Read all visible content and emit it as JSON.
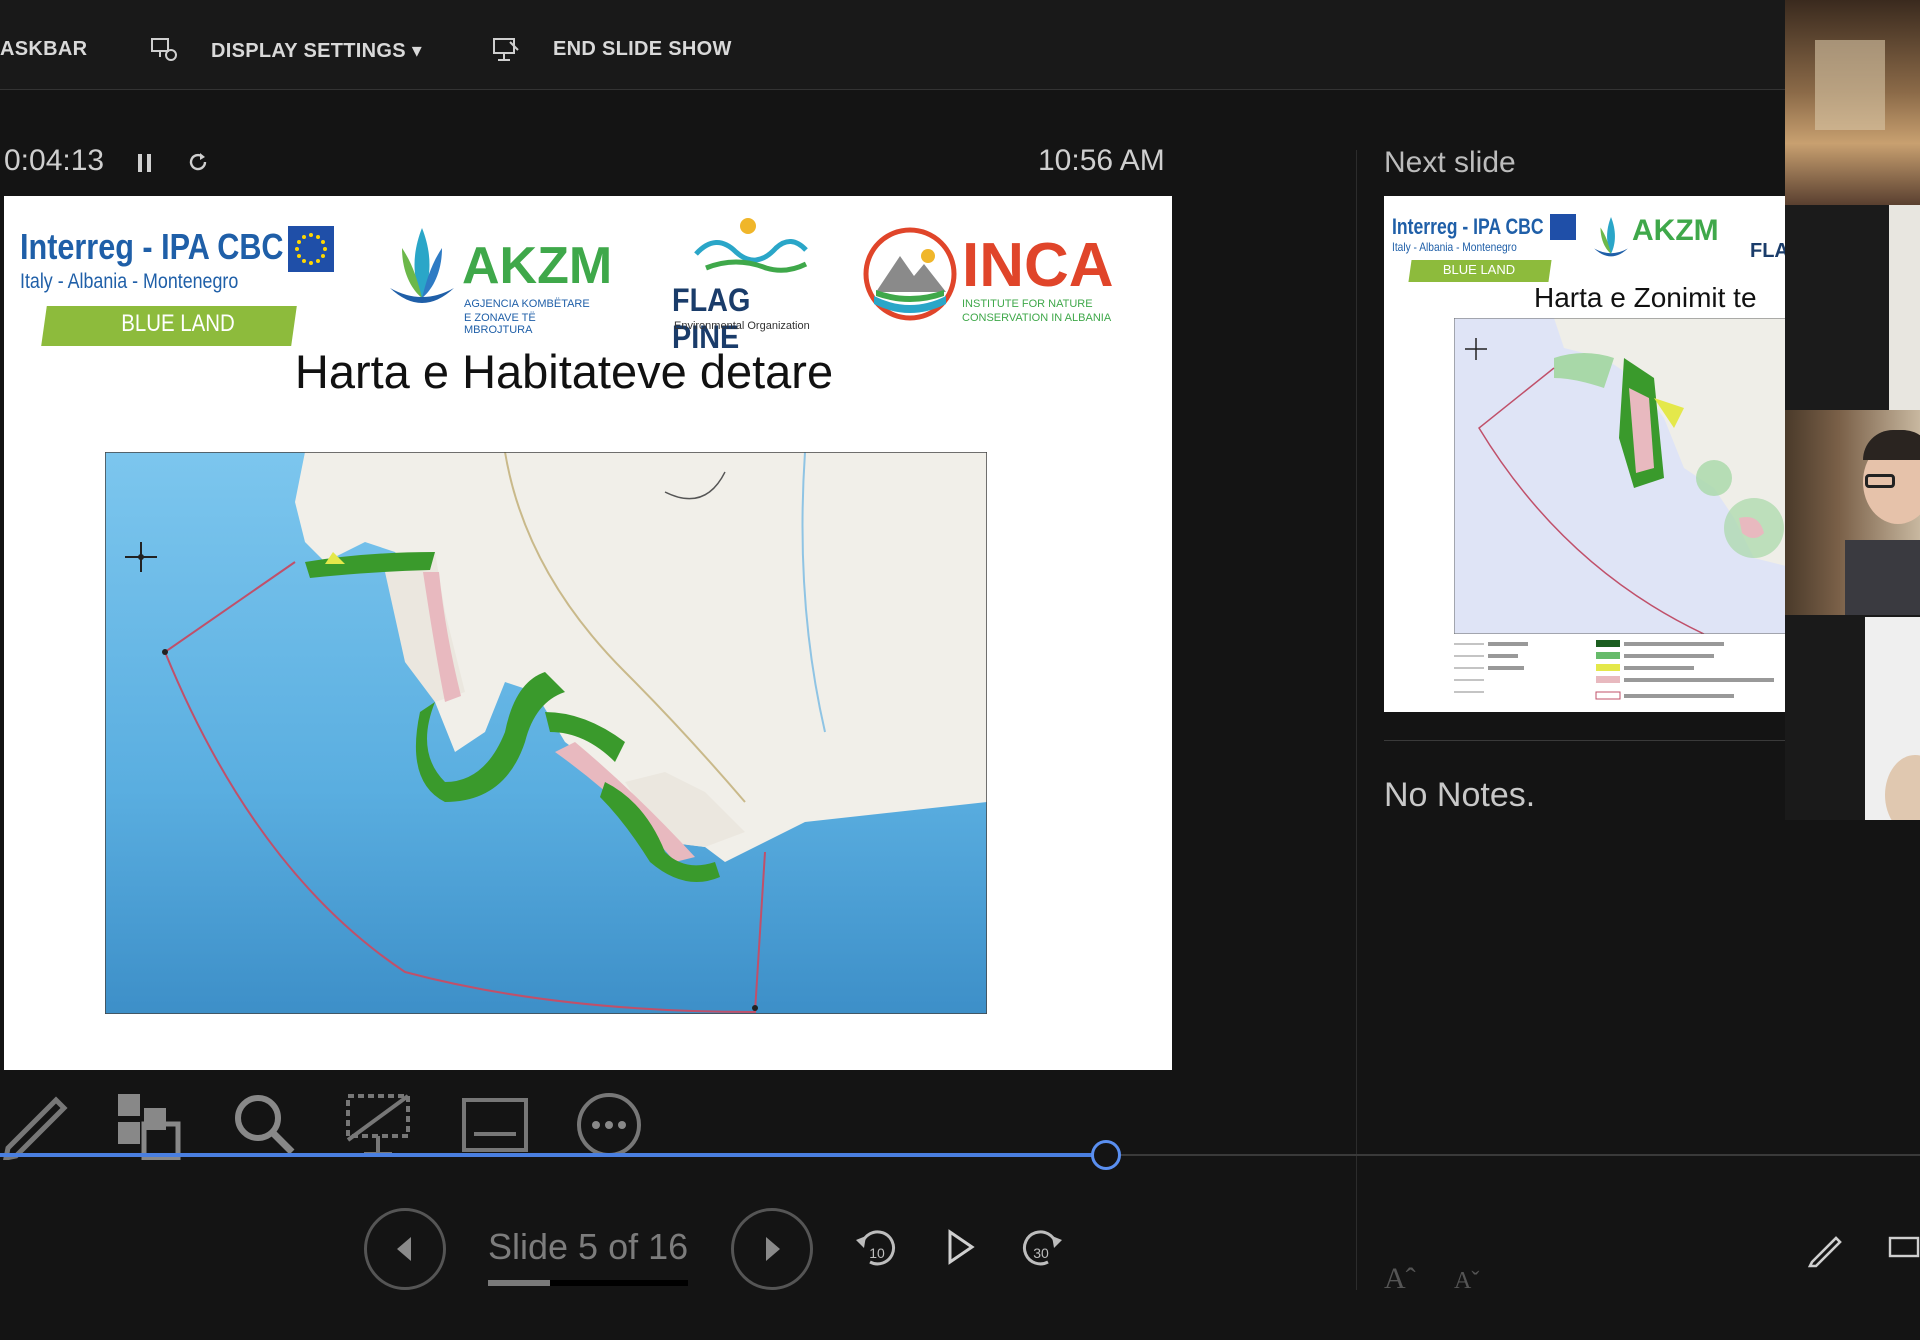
{
  "toolbar": {
    "taskbar_label": "ASKBAR",
    "display_settings_label": "DISPLAY SETTINGS ▾",
    "end_show_label": "END SLIDE SHOW"
  },
  "presenter": {
    "elapsed": "0:04:13",
    "clock": "10:56 AM",
    "next_slide_label": "Next slide",
    "notes": "No Notes.",
    "progress_fraction": 0.576
  },
  "current_slide": {
    "title": "Harta e Habitateve detare",
    "logos": {
      "interreg": "Interreg - IPA CBC",
      "interreg_sub": "Italy - Albania - Montenegro",
      "blueland": "BLUE LAND",
      "akzm": "AKZM",
      "akzm_sub1": "AGJENCIA KOMBËTARE",
      "akzm_sub2": "E ZONAVE TË MBROJTURA",
      "flagpine": "FLAG PINE",
      "flagpine_sub": "Environmental Organization",
      "inca": "INCA",
      "inca_sub1": "INSTITUTE FOR NATURE",
      "inca_sub2": "CONSERVATION IN ALBANIA"
    }
  },
  "next_slide": {
    "title": "Harta e Zonimit te",
    "interreg": "Interreg - IPA CBC",
    "interreg_sub": "Italy - Albania - Montenegro",
    "blueland": "BLUE LAND",
    "akzm": "AKZM",
    "flag": "FLA"
  },
  "navigation": {
    "counter": "Slide 5 of 16",
    "counter_fraction": 0.31
  }
}
